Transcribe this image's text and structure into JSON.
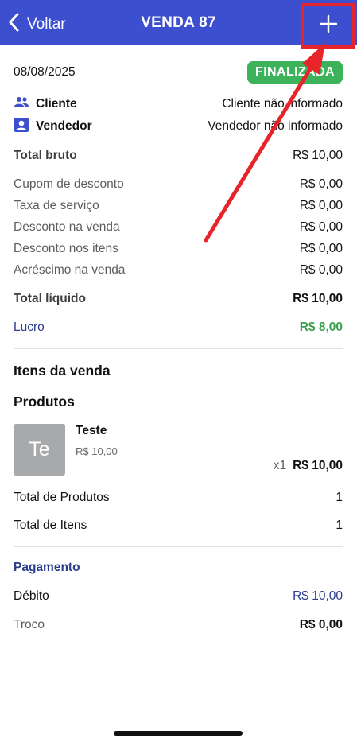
{
  "header": {
    "back_label": "Voltar",
    "title": "VENDA 87"
  },
  "sale": {
    "date": "08/08/2025",
    "status": "FINALIZADA",
    "cliente_label": "Cliente",
    "cliente_value": "Cliente não informado",
    "vendedor_label": "Vendedor",
    "vendedor_value": "Vendedor não informado"
  },
  "totals": {
    "total_bruto_label": "Total bruto",
    "total_bruto_value": "R$ 10,00",
    "cupom_label": "Cupom de desconto",
    "cupom_value": "R$ 0,00",
    "taxa_label": "Taxa de serviço",
    "taxa_value": "R$ 0,00",
    "desc_venda_label": "Desconto na venda",
    "desc_venda_value": "R$ 0,00",
    "desc_itens_label": "Desconto nos itens",
    "desc_itens_value": "R$ 0,00",
    "acrescimo_label": "Acréscimo na venda",
    "acrescimo_value": "R$ 0,00",
    "total_liquido_label": "Total líquido",
    "total_liquido_value": "R$ 10,00",
    "lucro_label": "Lucro",
    "lucro_value": "R$ 8,00"
  },
  "items": {
    "section_title": "Itens da venda",
    "products_title": "Produtos",
    "product": {
      "thumb_initials": "Te",
      "name": "Teste",
      "unit_price": "R$ 10,00",
      "qty": "x1",
      "total": "R$ 10,00"
    },
    "total_produtos_label": "Total de Produtos",
    "total_produtos_value": "1",
    "total_itens_label": "Total de Itens",
    "total_itens_value": "1"
  },
  "payment": {
    "section_title": "Pagamento",
    "debito_label": "Débito",
    "debito_value": "R$ 10,00",
    "troco_label": "Troco",
    "troco_value": "R$ 0,00"
  },
  "colors": {
    "header": "#3c4fcf",
    "status_badge": "#3cb35a",
    "accent_blue": "#2a3c8c",
    "profit_green": "#3aa04f",
    "annotation_red": "#e8242b"
  },
  "icons": {
    "back": "chevron-left-icon",
    "add": "plus-icon",
    "cliente": "people-icon",
    "vendedor": "person-badge-icon"
  }
}
